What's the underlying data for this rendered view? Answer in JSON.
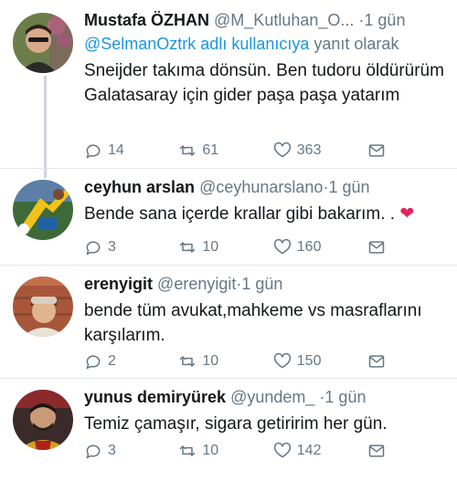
{
  "tweets": [
    {
      "display_name": "Mustafa ÖZHAN",
      "handle": "@M_Kutluhan_O...",
      "dot": "·",
      "time": "1 gün",
      "reply_mention": "@SelmanOztrk adlı kullanıcıya",
      "reply_suffix": "yanıt olarak",
      "text": "Sneijder takıma dönsün. Ben tudoru öldürürüm Galatasaray için gider paşa paşa yatarım",
      "replies": "14",
      "retweets": "61",
      "likes": "363"
    },
    {
      "display_name": "ceyhun arslan",
      "handle": "@ceyhunarslano",
      "dot": "·",
      "time": "1 gün",
      "text": "Bende sana içerde krallar gibi bakarım. .",
      "emoji": "❤",
      "replies": "3",
      "retweets": "10",
      "likes": "160"
    },
    {
      "display_name": "erenyigit",
      "handle": "@erenyigit",
      "dot": "·",
      "time": "1 gün",
      "text": "bende tüm avukat,mahkeme vs masraflarını karşılarım.",
      "replies": "2",
      "retweets": "10",
      "likes": "150"
    },
    {
      "display_name": "yunus demiryürek",
      "handle": "@yundem_",
      "dot": "·",
      "time": "1 gün",
      "text": "Temiz çamaşır, sigara getiririm her gün.",
      "replies": "3",
      "retweets": "10",
      "likes": "142"
    }
  ],
  "colors": {
    "link": "#1b95e0",
    "secondary_text": "#657786",
    "primary_text": "#14171a",
    "heart": "#e0245e"
  },
  "icons": [
    "reply-icon",
    "retweet-icon",
    "like-icon",
    "message-icon"
  ]
}
